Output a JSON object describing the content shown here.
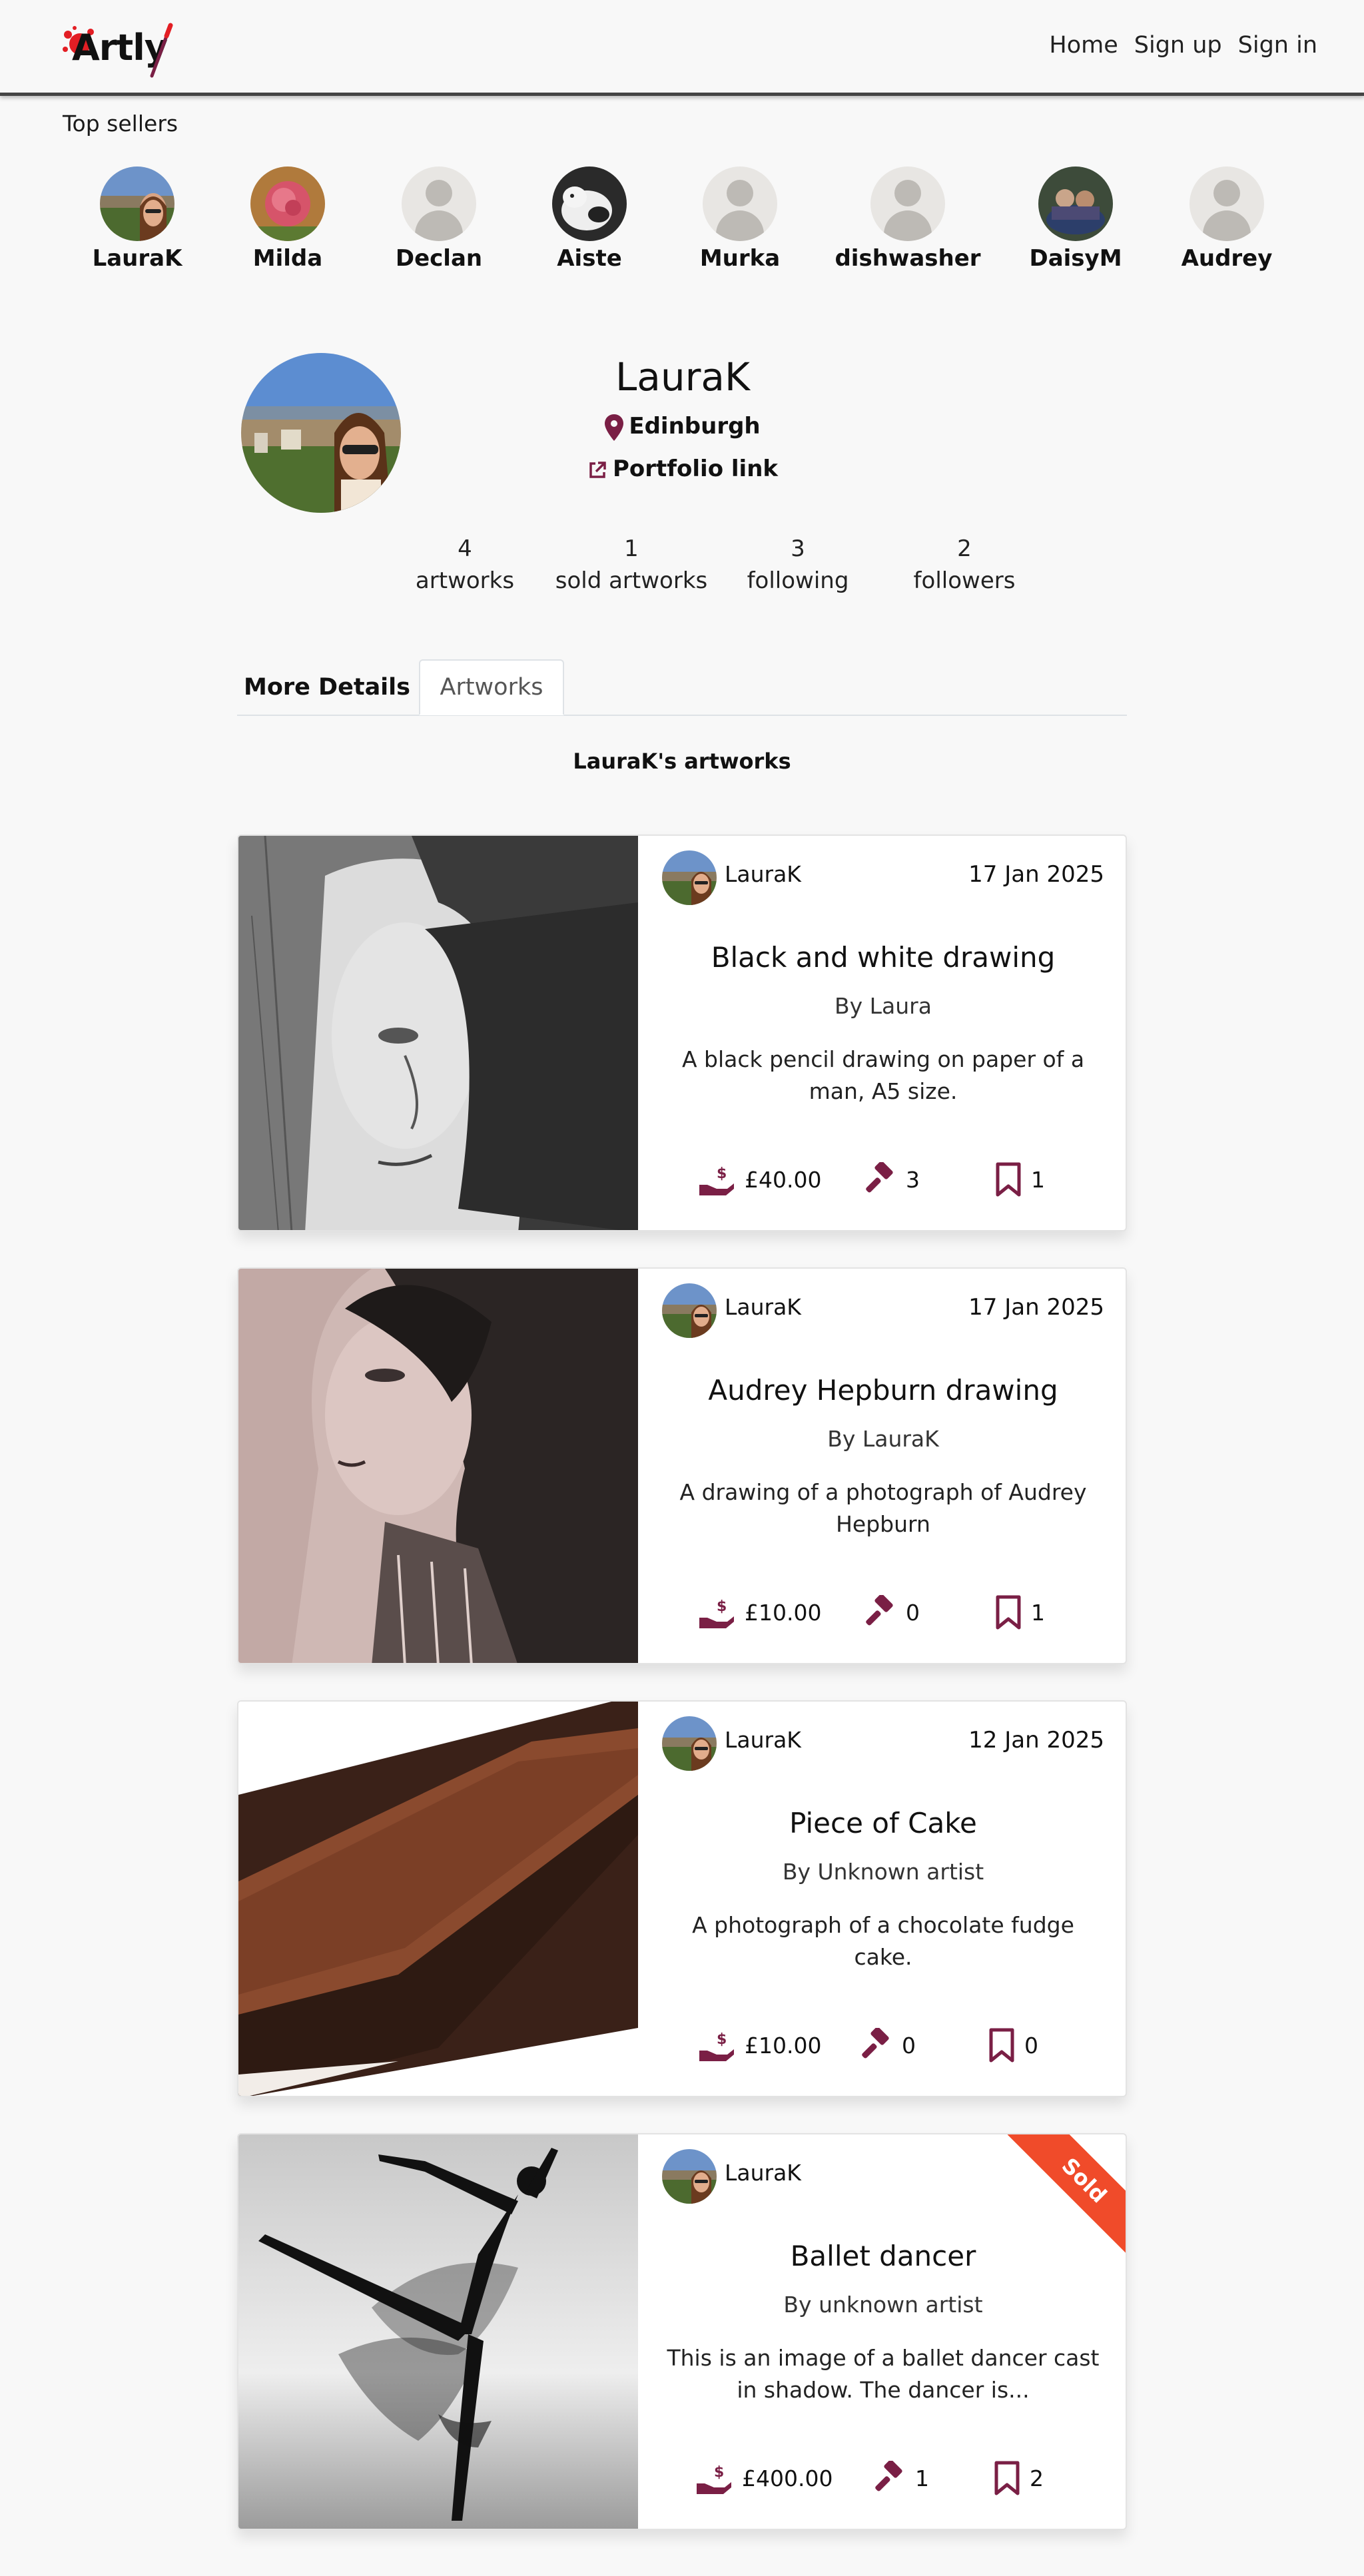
{
  "nav": {
    "logo_text": "Artly",
    "links": [
      "Home",
      "Sign up",
      "Sign in"
    ]
  },
  "top_sellers": {
    "title": "Top sellers",
    "sellers": [
      "LauraK",
      "Milda",
      "Declan",
      "Aiste",
      "Murka",
      "dishwasher",
      "DaisyM",
      "Audrey"
    ]
  },
  "profile": {
    "name": "LauraK",
    "location": "Edinburgh",
    "portfolio_label": "Portfolio link",
    "stats": [
      {
        "value": "4",
        "label": "artworks"
      },
      {
        "value": "1",
        "label": "sold artworks"
      },
      {
        "value": "3",
        "label": "following"
      },
      {
        "value": "2",
        "label": "followers"
      }
    ]
  },
  "tabs": [
    "More Details",
    "Artworks"
  ],
  "active_tab": "Artworks",
  "artworks_heading": "LauraK's artworks",
  "artworks": [
    {
      "user": "LauraK",
      "date": "17 Jan 2025",
      "title": "Black and white drawing",
      "author": "By Laura",
      "description": "A black pencil drawing on paper of a man, A5 size.",
      "price": "£40.00",
      "bids": "3",
      "saves": "1",
      "sold": false
    },
    {
      "user": "LauraK",
      "date": "17 Jan 2025",
      "title": "Audrey Hepburn drawing",
      "author": "By LauraK",
      "description": "A drawing of a photograph of Audrey Hepburn",
      "price": "£10.00",
      "bids": "0",
      "saves": "1",
      "sold": false
    },
    {
      "user": "LauraK",
      "date": "12 Jan 2025",
      "title": "Piece of Cake",
      "author": "By Unknown artist",
      "description": "A photograph of a chocolate fudge cake.",
      "price": "£10.00",
      "bids": "0",
      "saves": "0",
      "sold": false
    },
    {
      "user": "LauraK",
      "date": "",
      "title": "Ballet dancer",
      "author": "By unknown artist",
      "description": "This is an image of a ballet dancer cast in shadow. The dancer is...",
      "price": "£400.00",
      "bids": "1",
      "saves": "2",
      "sold": true,
      "sold_label": "Sold"
    }
  ],
  "colors": {
    "accent": "#7a1f45",
    "sold_ribbon": "#f04b2a",
    "background": "#f8f8f8"
  },
  "icons": {
    "price": "hand-dollar-icon",
    "bids": "gavel-icon",
    "saves": "bookmark-icon",
    "location": "map-pin-icon",
    "portfolio": "external-link-icon"
  }
}
